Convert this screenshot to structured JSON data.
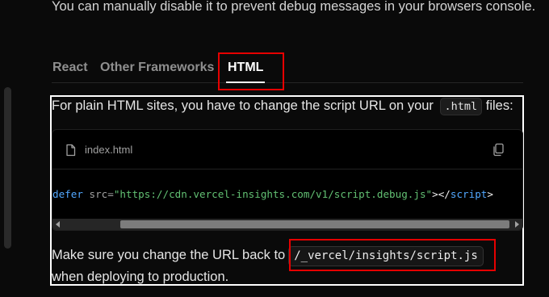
{
  "intro": {
    "text": "You can manually disable it to prevent debug messages in your browsers console."
  },
  "tabs": [
    {
      "label": "React",
      "active": false
    },
    {
      "label": "Other Frameworks",
      "active": false
    },
    {
      "label": "HTML",
      "active": true
    }
  ],
  "content": {
    "para1_text": "For plain HTML sites, you have to change the script URL on your",
    "para1_code": ".html",
    "para1_suffix": " files:",
    "code_block": {
      "file_icon": "file-icon",
      "filename": "index.html",
      "copy_icon": "copy-icon",
      "code_tokens": {
        "kw": "defer",
        "attr": " src=",
        "str": "\"https://cdn.vercel-insights.com/v1/script.debug.js\"",
        "close": "></",
        "tag": "script",
        "end": ">"
      }
    },
    "para2_text": "Make sure you change the URL back to",
    "para2_code": "/_vercel/insights/script.js",
    "para2_line2": "when deploying to production."
  },
  "colors": {
    "background": "#0a0a0a",
    "highlight_red": "#e60000",
    "keyword_blue": "#52a8ff",
    "string_green": "#62c073"
  }
}
